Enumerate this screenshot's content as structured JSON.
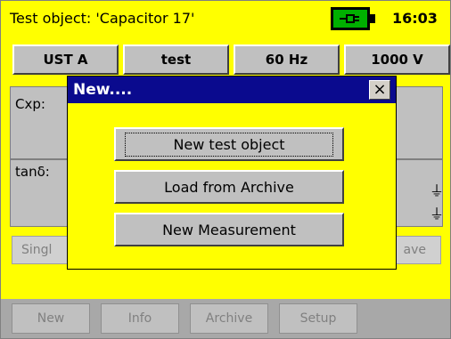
{
  "header": {
    "title": "Test object: 'Capacitor 17'",
    "time": "16:03",
    "battery_icon": "battery-plug-icon",
    "battery_color": "#00aa00"
  },
  "top_buttons": [
    "UST A",
    "test",
    "60 Hz",
    "1000 V"
  ],
  "panels": {
    "cxp_label": "Cxp:",
    "tand_label": "tanδ:"
  },
  "mid_buttons": {
    "left_partial": "Singl",
    "right_partial": "ave"
  },
  "bottom_buttons": [
    "New",
    "Info",
    "Archive",
    "Setup"
  ],
  "dialog": {
    "title": "New....",
    "close_label": "×",
    "buttons": [
      "New test object",
      "Load from Archive",
      "New Measurement"
    ]
  },
  "colors": {
    "background": "#ffff00",
    "dialog_title_bar": "#0a0a8e",
    "button_face": "#c0c0c0"
  }
}
